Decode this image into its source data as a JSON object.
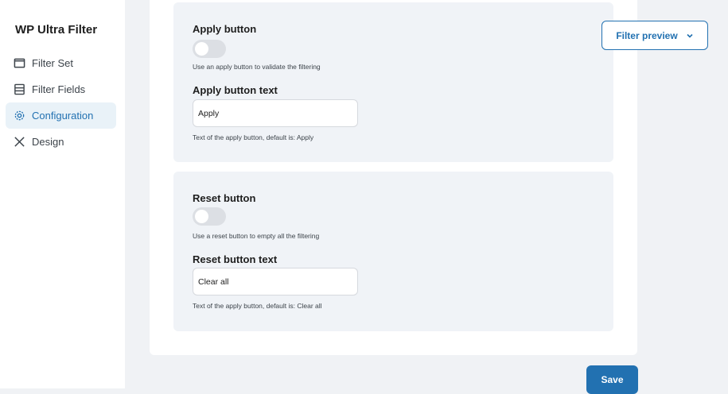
{
  "brand": "WP Ultra Filter",
  "nav": [
    {
      "label": "Filter Set"
    },
    {
      "label": "Filter Fields"
    },
    {
      "label": "Configuration"
    },
    {
      "label": "Design"
    }
  ],
  "preview": {
    "label": "Filter preview"
  },
  "apply": {
    "label": "Apply button",
    "enabled": false,
    "help": "Use an apply button to validate the filtering",
    "text_label": "Apply button text",
    "text_value": "Apply",
    "text_help": "Text of the apply button, default is: Apply"
  },
  "reset": {
    "label": "Reset button",
    "enabled": false,
    "help": "Use a reset button to empty all the filtering",
    "text_label": "Reset button text",
    "text_value": "Clear all",
    "text_help": "Text of the apply button, default is: Clear all"
  },
  "save": {
    "label": "Save"
  },
  "colors": {
    "accent": "#2271b1"
  }
}
